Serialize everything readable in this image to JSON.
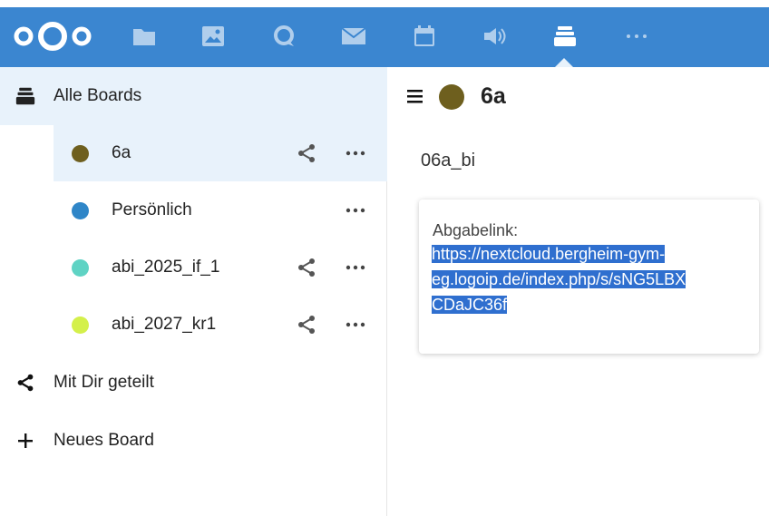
{
  "topbar": {
    "apps": [
      {
        "name": "files",
        "icon": "folder-icon"
      },
      {
        "name": "photos",
        "icon": "image-icon"
      },
      {
        "name": "talk",
        "icon": "chat-icon"
      },
      {
        "name": "mail",
        "icon": "mail-icon"
      },
      {
        "name": "calendar",
        "icon": "calendar-icon"
      },
      {
        "name": "announcements",
        "icon": "speaker-icon"
      },
      {
        "name": "deck",
        "icon": "deck-icon",
        "active": true
      },
      {
        "name": "more",
        "icon": "more-icon"
      }
    ],
    "colors": {
      "bar": "#3b86d0"
    }
  },
  "sidebar": {
    "all_boards_label": "Alle Boards",
    "boards": [
      {
        "label": "6a",
        "color": "#6e5f1e",
        "shared": true,
        "selected": true
      },
      {
        "label": "Persönlich",
        "color": "#2f86c8",
        "shared": false
      },
      {
        "label": "abi_2025_if_1",
        "color": "#5fd3c4",
        "shared": true
      },
      {
        "label": "abi_2027_kr1",
        "color": "#d4f04b",
        "shared": true
      }
    ],
    "shared_label": "Mit Dir geteilt",
    "new_board_label": "Neues Board"
  },
  "main": {
    "board_title": "6a",
    "stack_title": "06a_bi",
    "card": {
      "label": "Abgabelink:",
      "link_lines": [
        "https://nextcloud.bergheim-gym-",
        "eg.logoip.de/index.php/s/sNG5LBX",
        "CDaJC36f"
      ]
    }
  }
}
